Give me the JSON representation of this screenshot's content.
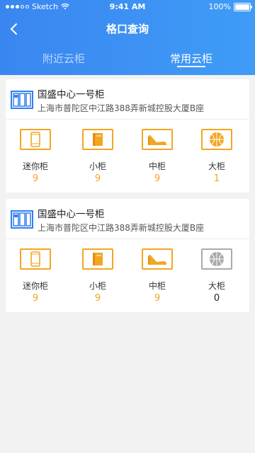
{
  "status_bar": {
    "carrier": "Sketch",
    "time": "9:41 AM",
    "battery": "100%"
  },
  "header": {
    "title": "格口查询"
  },
  "tabs": [
    {
      "label": "附近云柜",
      "active": false
    },
    {
      "label": "常用云柜",
      "active": true
    }
  ],
  "lockers": [
    {
      "name": "国盛中心一号柜",
      "address": "上海市普陀区中江路388弄新城控股大厦B座",
      "sizes": [
        {
          "label": "迷你柜",
          "count": "9",
          "icon": "phone-icon",
          "available": true
        },
        {
          "label": "小柜",
          "count": "9",
          "icon": "book-icon",
          "available": true
        },
        {
          "label": "中柜",
          "count": "9",
          "icon": "shoe-icon",
          "available": true
        },
        {
          "label": "大柜",
          "count": "1",
          "icon": "basketball-icon",
          "available": true
        }
      ]
    },
    {
      "name": "国盛中心一号柜",
      "address": "上海市普陀区中江路388弄新城控股大厦B座",
      "sizes": [
        {
          "label": "迷你柜",
          "count": "9",
          "icon": "phone-icon",
          "available": true
        },
        {
          "label": "小柜",
          "count": "9",
          "icon": "book-icon",
          "available": true
        },
        {
          "label": "中柜",
          "count": "9",
          "icon": "shoe-icon",
          "available": true
        },
        {
          "label": "大柜",
          "count": "0",
          "icon": "basketball-icon",
          "available": false
        }
      ]
    }
  ],
  "colors": {
    "primary": "#3a86f0",
    "accent": "#f2a623",
    "disabled": "#aaaaaa"
  }
}
